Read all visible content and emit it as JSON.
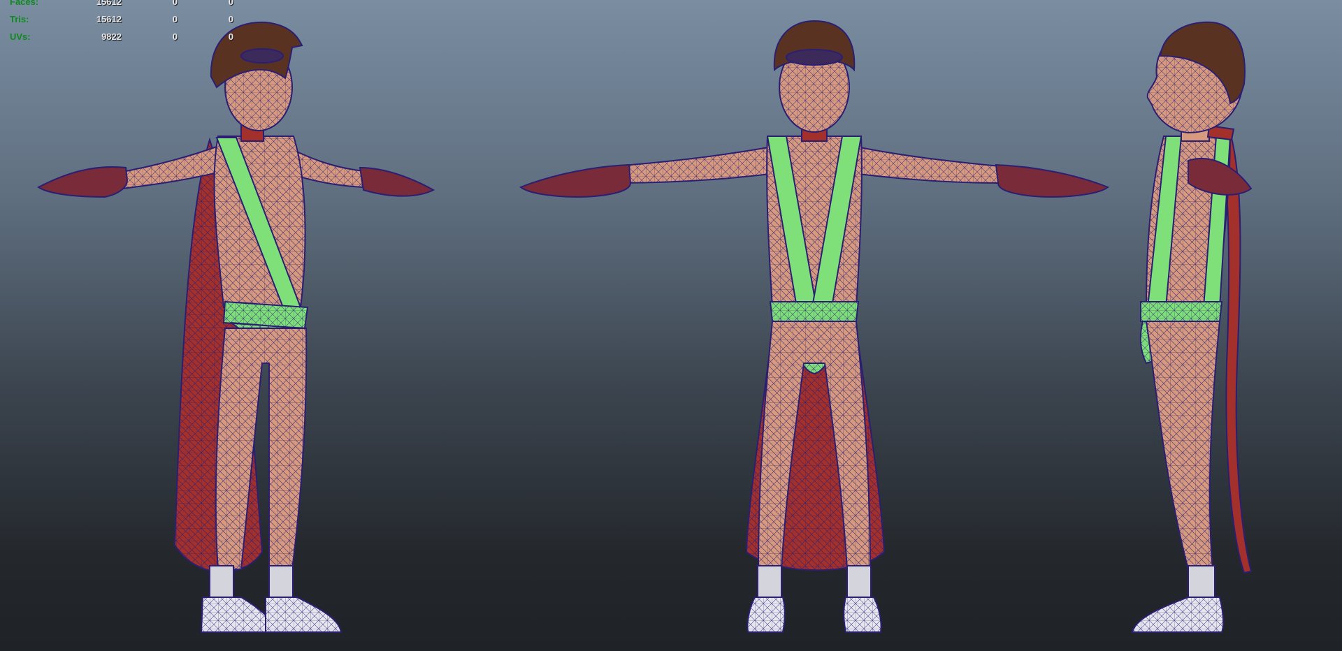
{
  "viewport": {
    "name": "Maya 3D viewport - wireframe on shaded character turnaround",
    "background_top": "#7a8da1",
    "background_bottom": "#1f2226"
  },
  "hud": {
    "rows": [
      {
        "label": "Faces:",
        "v1": "15612",
        "v2": "0",
        "v3": "0"
      },
      {
        "label": "Tris:",
        "v1": "15612",
        "v2": "0",
        "v3": "0"
      },
      {
        "label": "UVs:",
        "v1": "9822",
        "v2": "0",
        "v3": "0"
      }
    ],
    "label_color": "#0f8a1e",
    "value_color": "#e4e4e4"
  },
  "character": {
    "views": [
      "three-quarter",
      "front",
      "side"
    ],
    "colors": {
      "skin": "#d79a7e",
      "suit_green": "#7fe07a",
      "cape_red": "#a3302a",
      "hair": "#5a3222",
      "glove": "#7a2b3a",
      "sock": "#d4d4dc",
      "shoe": "#e6e6ee",
      "wire": "#2a1f73"
    }
  }
}
